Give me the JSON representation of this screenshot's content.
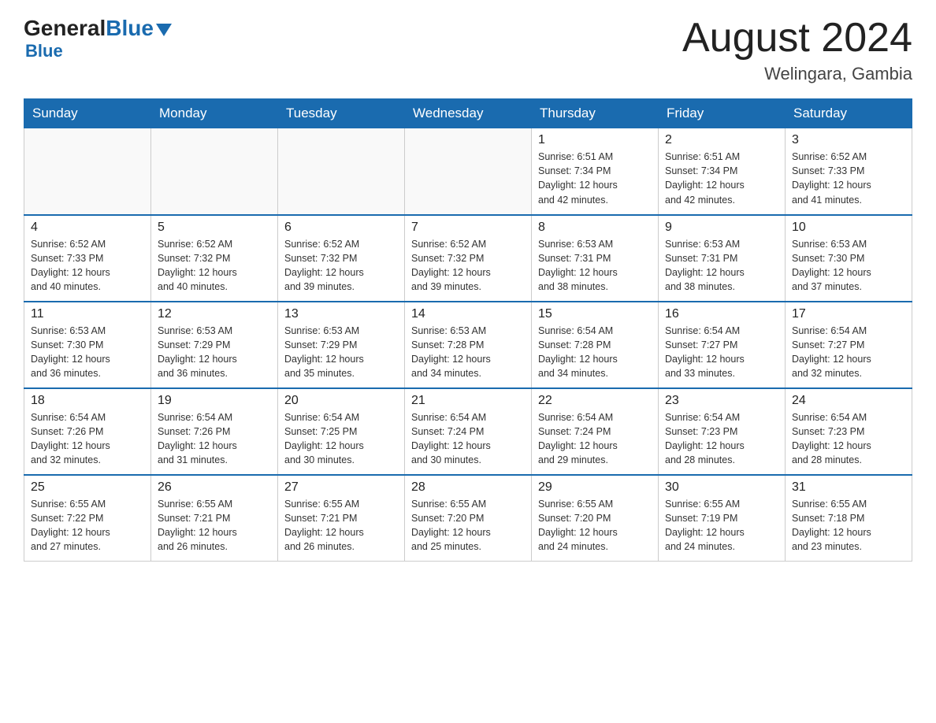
{
  "header": {
    "logo_general": "General",
    "logo_blue": "Blue",
    "month_year": "August 2024",
    "location": "Welingara, Gambia"
  },
  "days_of_week": [
    "Sunday",
    "Monday",
    "Tuesday",
    "Wednesday",
    "Thursday",
    "Friday",
    "Saturday"
  ],
  "weeks": [
    [
      {
        "day": "",
        "info": ""
      },
      {
        "day": "",
        "info": ""
      },
      {
        "day": "",
        "info": ""
      },
      {
        "day": "",
        "info": ""
      },
      {
        "day": "1",
        "info": "Sunrise: 6:51 AM\nSunset: 7:34 PM\nDaylight: 12 hours\nand 42 minutes."
      },
      {
        "day": "2",
        "info": "Sunrise: 6:51 AM\nSunset: 7:34 PM\nDaylight: 12 hours\nand 42 minutes."
      },
      {
        "day": "3",
        "info": "Sunrise: 6:52 AM\nSunset: 7:33 PM\nDaylight: 12 hours\nand 41 minutes."
      }
    ],
    [
      {
        "day": "4",
        "info": "Sunrise: 6:52 AM\nSunset: 7:33 PM\nDaylight: 12 hours\nand 40 minutes."
      },
      {
        "day": "5",
        "info": "Sunrise: 6:52 AM\nSunset: 7:32 PM\nDaylight: 12 hours\nand 40 minutes."
      },
      {
        "day": "6",
        "info": "Sunrise: 6:52 AM\nSunset: 7:32 PM\nDaylight: 12 hours\nand 39 minutes."
      },
      {
        "day": "7",
        "info": "Sunrise: 6:52 AM\nSunset: 7:32 PM\nDaylight: 12 hours\nand 39 minutes."
      },
      {
        "day": "8",
        "info": "Sunrise: 6:53 AM\nSunset: 7:31 PM\nDaylight: 12 hours\nand 38 minutes."
      },
      {
        "day": "9",
        "info": "Sunrise: 6:53 AM\nSunset: 7:31 PM\nDaylight: 12 hours\nand 38 minutes."
      },
      {
        "day": "10",
        "info": "Sunrise: 6:53 AM\nSunset: 7:30 PM\nDaylight: 12 hours\nand 37 minutes."
      }
    ],
    [
      {
        "day": "11",
        "info": "Sunrise: 6:53 AM\nSunset: 7:30 PM\nDaylight: 12 hours\nand 36 minutes."
      },
      {
        "day": "12",
        "info": "Sunrise: 6:53 AM\nSunset: 7:29 PM\nDaylight: 12 hours\nand 36 minutes."
      },
      {
        "day": "13",
        "info": "Sunrise: 6:53 AM\nSunset: 7:29 PM\nDaylight: 12 hours\nand 35 minutes."
      },
      {
        "day": "14",
        "info": "Sunrise: 6:53 AM\nSunset: 7:28 PM\nDaylight: 12 hours\nand 34 minutes."
      },
      {
        "day": "15",
        "info": "Sunrise: 6:54 AM\nSunset: 7:28 PM\nDaylight: 12 hours\nand 34 minutes."
      },
      {
        "day": "16",
        "info": "Sunrise: 6:54 AM\nSunset: 7:27 PM\nDaylight: 12 hours\nand 33 minutes."
      },
      {
        "day": "17",
        "info": "Sunrise: 6:54 AM\nSunset: 7:27 PM\nDaylight: 12 hours\nand 32 minutes."
      }
    ],
    [
      {
        "day": "18",
        "info": "Sunrise: 6:54 AM\nSunset: 7:26 PM\nDaylight: 12 hours\nand 32 minutes."
      },
      {
        "day": "19",
        "info": "Sunrise: 6:54 AM\nSunset: 7:26 PM\nDaylight: 12 hours\nand 31 minutes."
      },
      {
        "day": "20",
        "info": "Sunrise: 6:54 AM\nSunset: 7:25 PM\nDaylight: 12 hours\nand 30 minutes."
      },
      {
        "day": "21",
        "info": "Sunrise: 6:54 AM\nSunset: 7:24 PM\nDaylight: 12 hours\nand 30 minutes."
      },
      {
        "day": "22",
        "info": "Sunrise: 6:54 AM\nSunset: 7:24 PM\nDaylight: 12 hours\nand 29 minutes."
      },
      {
        "day": "23",
        "info": "Sunrise: 6:54 AM\nSunset: 7:23 PM\nDaylight: 12 hours\nand 28 minutes."
      },
      {
        "day": "24",
        "info": "Sunrise: 6:54 AM\nSunset: 7:23 PM\nDaylight: 12 hours\nand 28 minutes."
      }
    ],
    [
      {
        "day": "25",
        "info": "Sunrise: 6:55 AM\nSunset: 7:22 PM\nDaylight: 12 hours\nand 27 minutes."
      },
      {
        "day": "26",
        "info": "Sunrise: 6:55 AM\nSunset: 7:21 PM\nDaylight: 12 hours\nand 26 minutes."
      },
      {
        "day": "27",
        "info": "Sunrise: 6:55 AM\nSunset: 7:21 PM\nDaylight: 12 hours\nand 26 minutes."
      },
      {
        "day": "28",
        "info": "Sunrise: 6:55 AM\nSunset: 7:20 PM\nDaylight: 12 hours\nand 25 minutes."
      },
      {
        "day": "29",
        "info": "Sunrise: 6:55 AM\nSunset: 7:20 PM\nDaylight: 12 hours\nand 24 minutes."
      },
      {
        "day": "30",
        "info": "Sunrise: 6:55 AM\nSunset: 7:19 PM\nDaylight: 12 hours\nand 24 minutes."
      },
      {
        "day": "31",
        "info": "Sunrise: 6:55 AM\nSunset: 7:18 PM\nDaylight: 12 hours\nand 23 minutes."
      }
    ]
  ]
}
